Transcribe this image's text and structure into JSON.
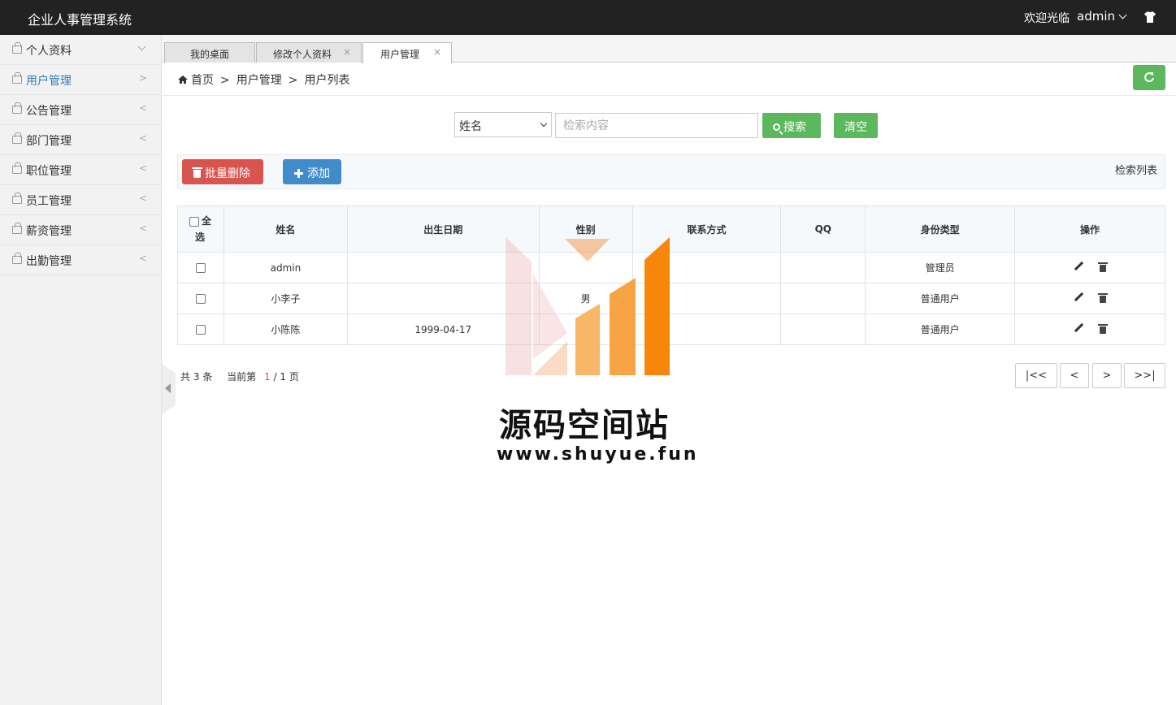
{
  "header": {
    "title": "企业人事管理系统",
    "welcome": "欢迎光临",
    "username": "admin"
  },
  "sidebar": {
    "items": [
      {
        "label": "个人资料",
        "arrow": "⌄"
      },
      {
        "label": "用户管理",
        "arrow": ">"
      },
      {
        "label": "公告管理",
        "arrow": "<"
      },
      {
        "label": "部门管理",
        "arrow": "<"
      },
      {
        "label": "职位管理",
        "arrow": "<"
      },
      {
        "label": "员工管理",
        "arrow": "<"
      },
      {
        "label": "薪资管理",
        "arrow": "<"
      },
      {
        "label": "出勤管理",
        "arrow": "<"
      }
    ],
    "active_index": 1
  },
  "tabs": [
    {
      "label": "我的桌面",
      "closable": false
    },
    {
      "label": "修改个人资料",
      "closable": true,
      "close": "×"
    },
    {
      "label": "用户管理",
      "closable": true,
      "close": "×",
      "active": true
    }
  ],
  "breadcrumb": {
    "items": [
      "首页",
      "用户管理",
      "用户列表"
    ],
    "separator": ">"
  },
  "search": {
    "field_selected": "姓名",
    "placeholder": "检索内容",
    "search_label": "搜索",
    "clear_label": "清空"
  },
  "toolbar": {
    "batch_delete_label": "批量删除",
    "add_label": "添加",
    "list_title": "检索列表"
  },
  "table": {
    "select_all_label_1": "全",
    "select_all_label_2": "选",
    "columns": [
      "姓名",
      "出生日期",
      "性别",
      "联系方式",
      "QQ",
      "身份类型",
      "操作"
    ],
    "rows": [
      {
        "name": "admin",
        "birth": "",
        "gender": "",
        "contact": "",
        "qq": "",
        "type": "管理员"
      },
      {
        "name": "小李子",
        "birth": "",
        "gender": "男",
        "contact": "",
        "qq": "",
        "type": "普通用户"
      },
      {
        "name": "小陈陈",
        "birth": "1999-04-17",
        "gender": "",
        "contact": "",
        "qq": "",
        "type": "普通用户"
      }
    ]
  },
  "pagination": {
    "total_prefix": "共",
    "total": "3",
    "total_suffix": "条",
    "current_prefix": "当前第",
    "current": "1",
    "slash": "/",
    "pages": "1",
    "pages_suffix": "页",
    "first": "|<<",
    "prev": "<",
    "next": ">",
    "last": ">>|"
  },
  "watermark": {
    "title": "源码空间站",
    "url": "www.shuyue.fun"
  },
  "colors": {
    "header_bg": "#222222",
    "green": "#5cb85c",
    "red": "#d9534f",
    "blue": "#428bca",
    "active_link": "#337ab7"
  }
}
